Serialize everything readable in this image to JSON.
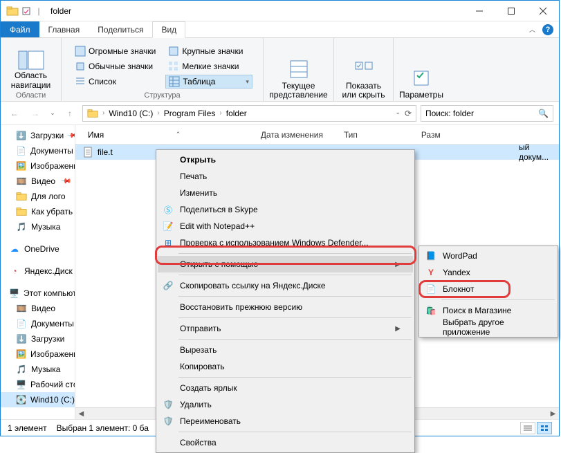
{
  "title": "folder",
  "tabs": {
    "file": "Файл",
    "home": "Главная",
    "share": "Поделиться",
    "view": "Вид"
  },
  "ribbon": {
    "nav_label": "Область\nнавигации",
    "nav_group": "Области",
    "layout": {
      "huge": "Огромные значки",
      "large": "Крупные значки",
      "normal": "Обычные значки",
      "small": "Мелкие значки",
      "list": "Список",
      "table": "Таблица"
    },
    "layout_group": "Структура",
    "current": "Текущее\nпредставление",
    "show": "Показать\nили скрыть",
    "params": "Параметры"
  },
  "breadcrumbs": [
    "Wind10 (C:)",
    "Program Files",
    "folder"
  ],
  "search_placeholder": "Поиск: folder",
  "tree": {
    "downloads": "Загрузки",
    "documents": "Документы",
    "images": "Изображени",
    "video": "Видео",
    "forlogo": "Для лого",
    "howto": "Как убрать паро",
    "music": "Музыка",
    "onedrive": "OneDrive",
    "yadisk": "Яндекс.Диск",
    "thispc": "Этот компьютер",
    "video2": "Видео",
    "documents2": "Документы",
    "downloads2": "Загрузки",
    "images2": "Изображения",
    "music2": "Музыка",
    "desktop": "Рабочий стол",
    "cdrive": "Wind10 (C:)"
  },
  "columns": {
    "name": "Имя",
    "date": "Дата изменения",
    "type": "Тип",
    "size": "Разм"
  },
  "file": {
    "name": "file.t",
    "type_suffix": "ый докум..."
  },
  "context": {
    "open": "Открыть",
    "print": "Печать",
    "edit": "Изменить",
    "skype": "Поделиться в Skype",
    "notepadpp": "Edit with Notepad++",
    "defender": "Проверка с использованием Windows Defender...",
    "openwith": "Открыть с помощью",
    "yandexlink": "Скопировать ссылку на Яндекс.Диске",
    "restore": "Восстановить прежнюю версию",
    "send": "Отправить",
    "cut": "Вырезать",
    "copy": "Копировать",
    "shortcut": "Создать ярлык",
    "delete": "Удалить",
    "rename": "Переименовать",
    "properties": "Свойства"
  },
  "submenu": {
    "wordpad": "WordPad",
    "yandex": "Yandex",
    "notepad": "Блокнот",
    "store": "Поиск в Магазине",
    "other": "Выбрать другое приложение"
  },
  "status": {
    "count": "1 элемент",
    "selection": "Выбран 1 элемент: 0 ба"
  }
}
